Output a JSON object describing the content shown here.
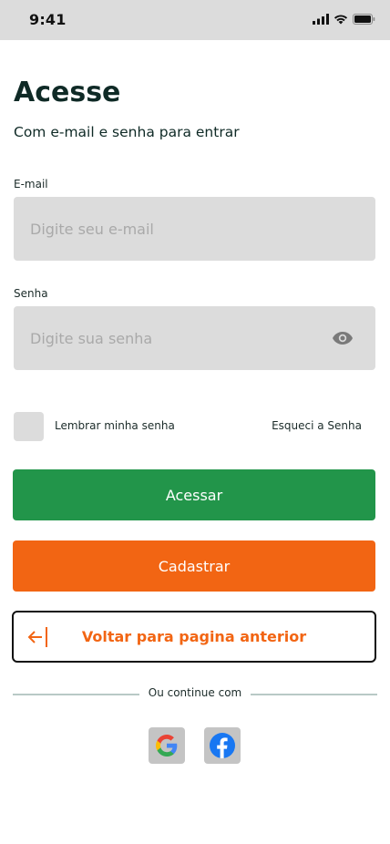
{
  "status_bar": {
    "time": "9:41"
  },
  "header": {
    "title": "Acesse",
    "subtitle": "Com e-mail e senha para entrar"
  },
  "form": {
    "email_label": "E-mail",
    "email_placeholder": "Digite seu e-mail",
    "email_value": "",
    "password_label": "Senha",
    "password_placeholder": "Digite sua senha",
    "password_value": "",
    "remember_label": "Lembrar minha senha",
    "remember_checked": false,
    "forgot_label": "Esqueci a Senha"
  },
  "actions": {
    "login_label": "Acessar",
    "register_label": "Cadastrar",
    "back_label": "Voltar para pagina anterior"
  },
  "social": {
    "divider_text": "Ou continue com",
    "providers": [
      {
        "name": "google-icon"
      },
      {
        "name": "facebook-icon"
      }
    ]
  },
  "colors": {
    "primary": "#22954a",
    "secondary": "#f26513",
    "field_bg": "#dcdcdc",
    "text_dark": "#0f2a26"
  }
}
